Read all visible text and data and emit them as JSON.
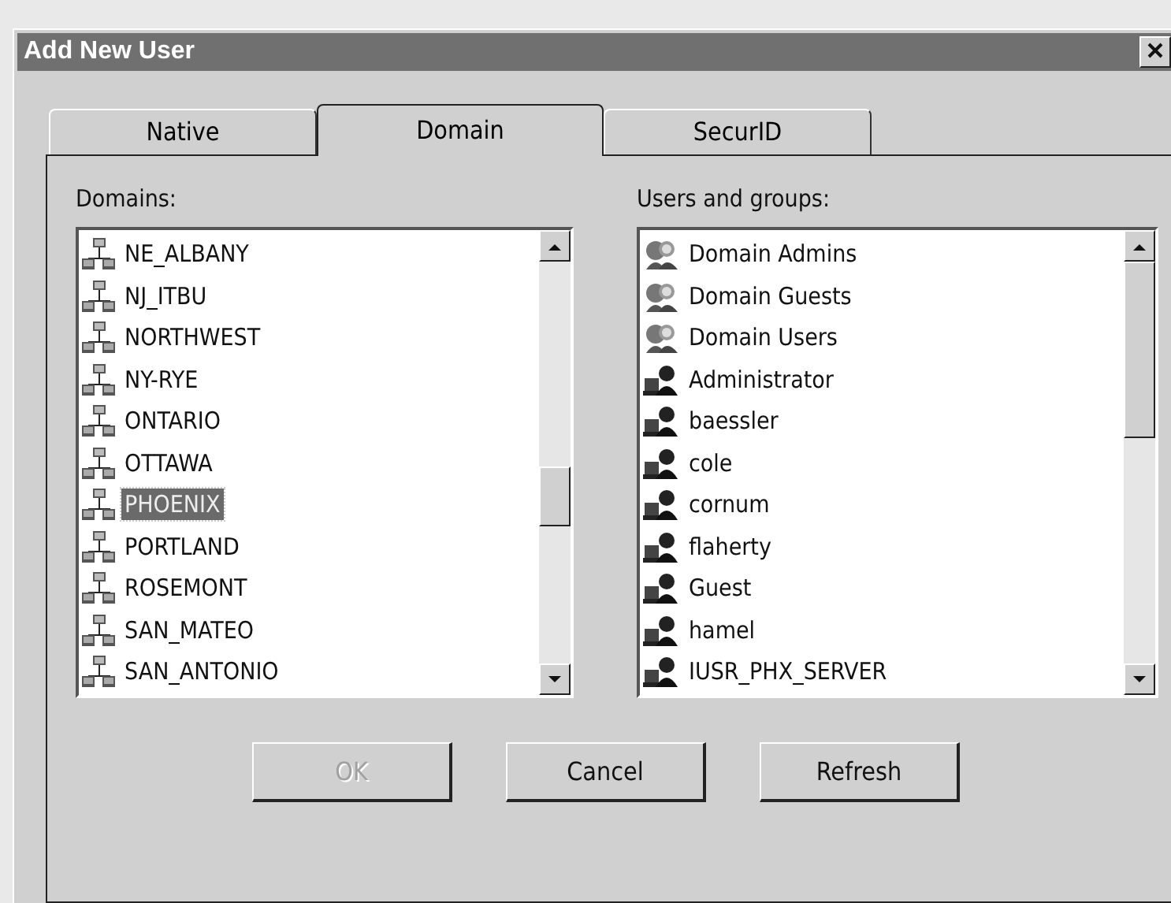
{
  "window": {
    "title": "Add New User"
  },
  "tabs": [
    {
      "label": "Native",
      "selected": false
    },
    {
      "label": "Domain",
      "selected": true
    },
    {
      "label": "SecurID",
      "selected": false
    }
  ],
  "domains": {
    "label": "Domains:",
    "items": [
      {
        "name": "NE_ALBANY",
        "selected": false
      },
      {
        "name": "NJ_ITBU",
        "selected": false
      },
      {
        "name": "NORTHWEST",
        "selected": false
      },
      {
        "name": "NY-RYE",
        "selected": false
      },
      {
        "name": "ONTARIO",
        "selected": false
      },
      {
        "name": "OTTAWA",
        "selected": false
      },
      {
        "name": "PHOENIX",
        "selected": true
      },
      {
        "name": "PORTLAND",
        "selected": false
      },
      {
        "name": "ROSEMONT",
        "selected": false
      },
      {
        "name": "SAN_MATEO",
        "selected": false
      },
      {
        "name": "SAN_ANTONIO",
        "selected": false
      }
    ]
  },
  "users_and_groups": {
    "label": "Users and groups:",
    "items": [
      {
        "name": "Domain Admins",
        "kind": "group"
      },
      {
        "name": "Domain Guests",
        "kind": "group"
      },
      {
        "name": "Domain Users",
        "kind": "group"
      },
      {
        "name": "Administrator",
        "kind": "user"
      },
      {
        "name": "baessler",
        "kind": "user"
      },
      {
        "name": "cole",
        "kind": "user"
      },
      {
        "name": "cornum",
        "kind": "user"
      },
      {
        "name": "flaherty",
        "kind": "user"
      },
      {
        "name": "Guest",
        "kind": "user"
      },
      {
        "name": "hamel",
        "kind": "user"
      },
      {
        "name": "IUSR_PHX_SERVER",
        "kind": "user"
      }
    ]
  },
  "buttons": [
    {
      "label": "OK",
      "disabled": true
    },
    {
      "label": "Cancel",
      "disabled": false
    },
    {
      "label": "Refresh",
      "disabled": false
    }
  ]
}
